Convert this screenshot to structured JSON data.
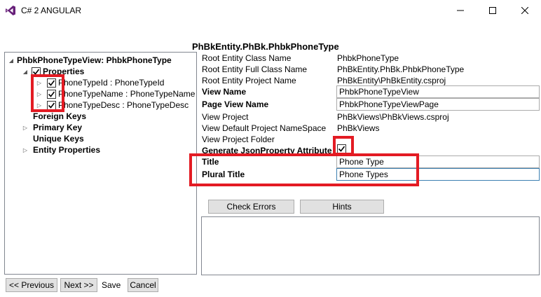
{
  "window": {
    "title": "C# 2 ANGULAR",
    "controls": {
      "minimize": "—",
      "maximize": "☐",
      "close": "✕"
    },
    "icon": "visual-studio-icon"
  },
  "header": {
    "title": "PhBkEntity.PhBk.PhbkPhoneType"
  },
  "tree": {
    "root_label": "PhbkPhoneTypeView: PhbkPhoneType",
    "properties_label": "Properties",
    "properties": [
      {
        "label": "PhoneTypeId : PhoneTypeId",
        "checked": true
      },
      {
        "label": "PhoneTypeName : PhoneTypeName",
        "checked": true
      },
      {
        "label": "PhoneTypeDesc : PhoneTypeDesc",
        "checked": true
      }
    ],
    "foreign_keys_label": "Foreign Keys",
    "primary_key_label": "Primary Key",
    "unique_keys_label": "Unique Keys",
    "entity_properties_label": "Entity Properties"
  },
  "props": {
    "root_entity_class_name": {
      "label": "Root Entity Class Name",
      "value": "PhbkPhoneType"
    },
    "root_entity_full_class_name": {
      "label": "Root Entity Full Class Name",
      "value": "PhBkEntity.PhBk.PhbkPhoneType"
    },
    "root_entity_project_name": {
      "label": "Root Entity Project Name",
      "value": "PhBkEntity\\PhBkEntity.csproj"
    },
    "view_name": {
      "label": "View Name",
      "value": "PhbkPhoneTypeView"
    },
    "page_view_name": {
      "label": "Page View Name",
      "value": "PhbkPhoneTypeViewPage"
    },
    "view_project": {
      "label": "View Project",
      "value": "PhBkViews\\PhBkViews.csproj"
    },
    "view_default_project_namespace": {
      "label": "View Default Project NameSpace",
      "value": "PhBkViews"
    },
    "view_project_folder": {
      "label": "View Project Folder",
      "value": ""
    },
    "generate_json_property_attribute": {
      "label": "Generate JsonProperty Attribute",
      "checked": true
    },
    "title": {
      "label": "Title",
      "value": "Phone Type"
    },
    "plural_title": {
      "label": "Plural Title",
      "value": "Phone Types"
    }
  },
  "buttons": {
    "check_errors": "Check Errors",
    "hints": "Hints",
    "previous": "<< Previous",
    "next": "Next >>",
    "save": "Save",
    "cancel": "Cancel"
  },
  "colors": {
    "highlight": "#e31b23",
    "border": "#828790",
    "button_bg": "#e1e1e1",
    "focus_border": "#3c7fb1"
  }
}
